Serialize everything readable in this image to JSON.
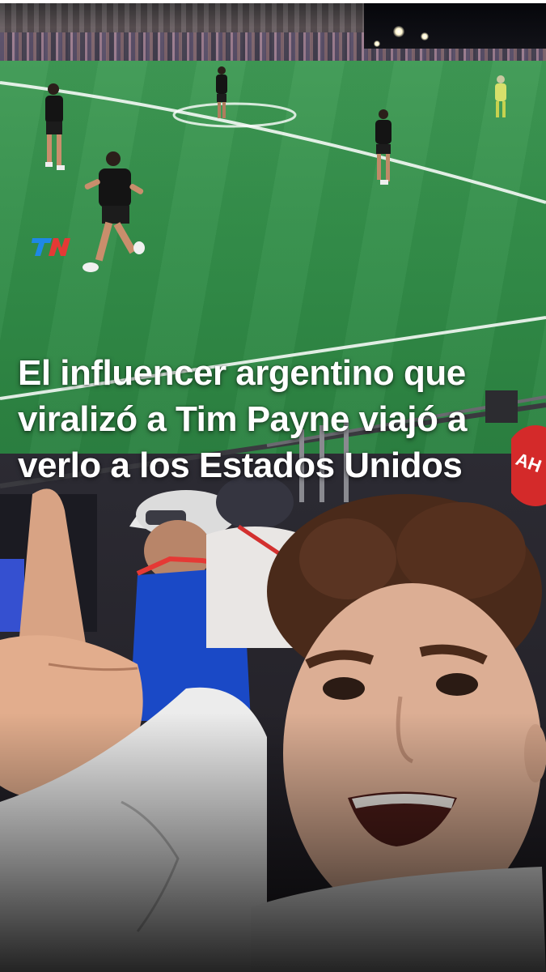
{
  "brand": {
    "logo_text": "TN",
    "logo_colors": [
      "#1e88e5",
      "#e53935"
    ]
  },
  "post": {
    "headline_lines": [
      "El influencer argentino que",
      "viralizó a Tim Payne viajó a",
      "verlo a los Estados Unidos"
    ],
    "headline_color": "#ffffff"
  },
  "scene": {
    "description_icon": "video-frame",
    "pitch_color": "#35904b",
    "jersey_color": "#141414"
  }
}
